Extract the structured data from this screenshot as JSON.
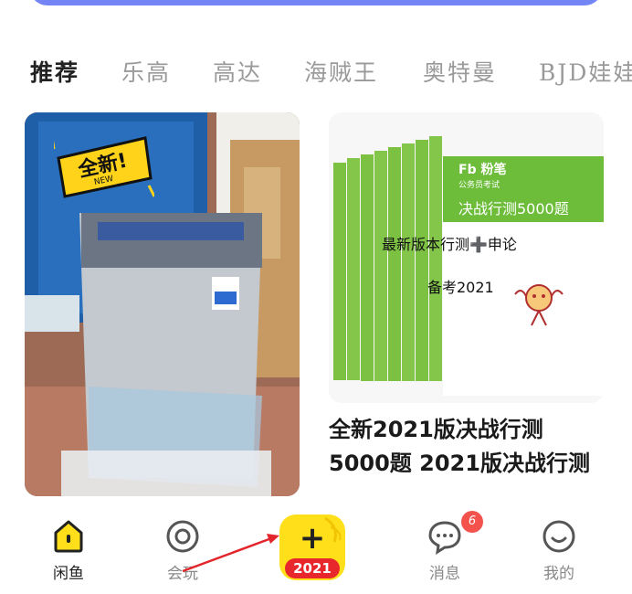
{
  "tabs": [
    {
      "label": "推荐",
      "active": true
    },
    {
      "label": "乐高",
      "active": false
    },
    {
      "label": "高达",
      "active": false
    },
    {
      "label": "海贼王",
      "active": false
    },
    {
      "label": "奥特曼",
      "active": false
    },
    {
      "label": "BJD娃娃",
      "active": false
    }
  ],
  "product_left": {
    "badge_text": "全新!",
    "badge_sub": "NEW"
  },
  "product_right": {
    "cover_brand": "Fb 粉笔",
    "cover_series": "公务员考试",
    "cover_title": "决战行测5000题",
    "overlay_line1": "最新版本行测➕申论",
    "overlay_line2": "备考2021",
    "title": "全新2021版决战行测5000题 2021版决战行测"
  },
  "nav": {
    "home": "闲鱼",
    "play": "会玩",
    "publish_year": "2021",
    "publish_plus": "+",
    "messages": "消息",
    "messages_badge": "6",
    "mine": "我的"
  },
  "colors": {
    "accent_yellow": "#ffdf1a",
    "badge_red": "#f4524d",
    "arrow_red": "#e3262b"
  }
}
